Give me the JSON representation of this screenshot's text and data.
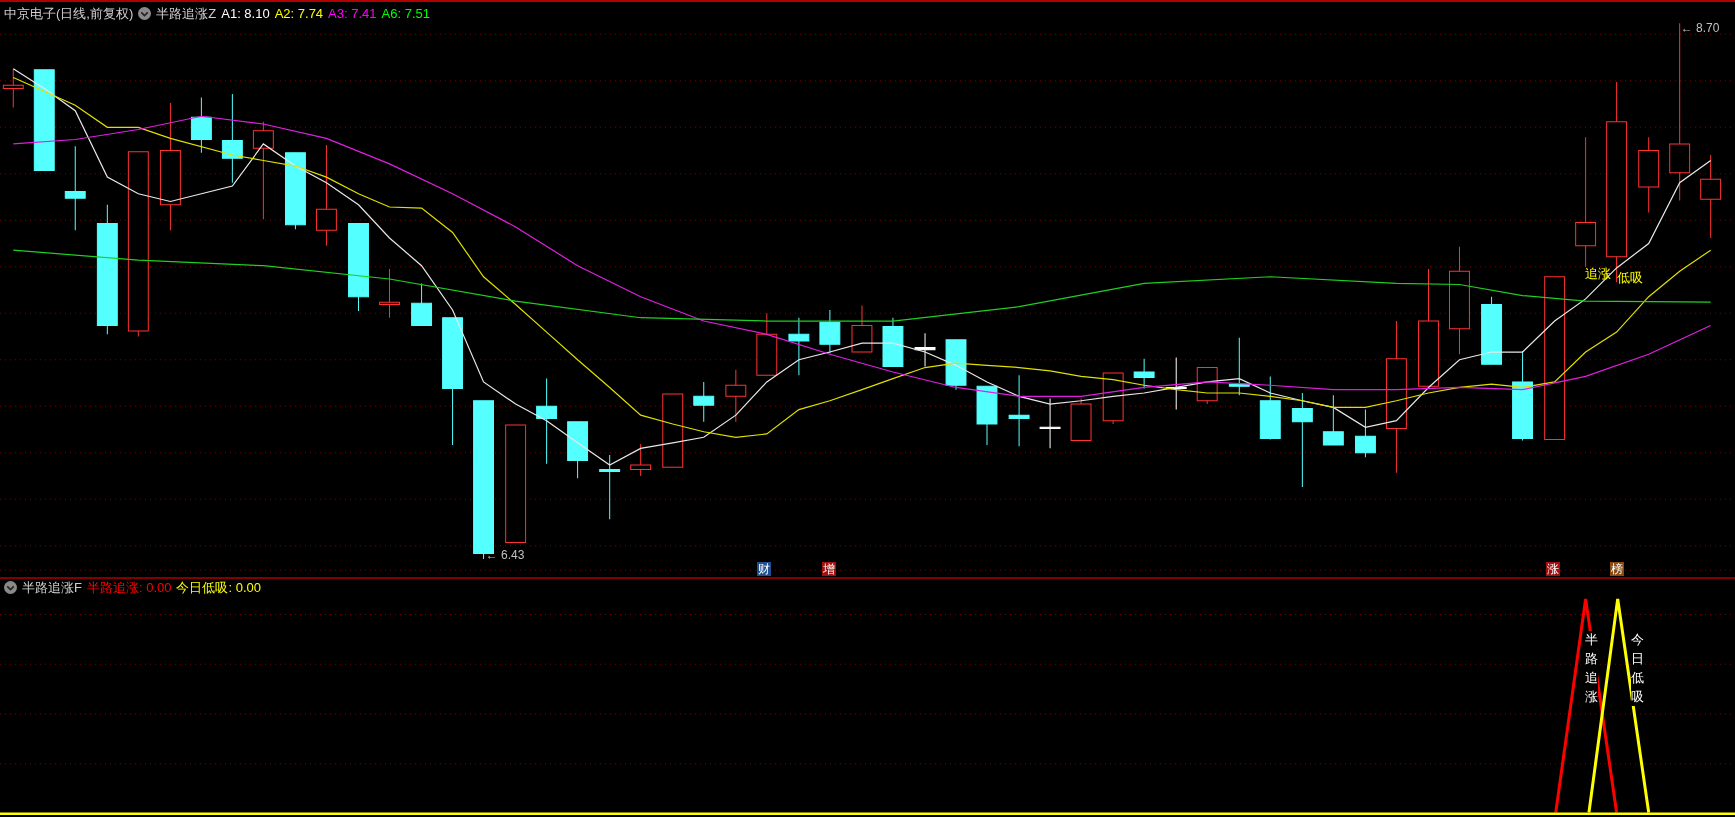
{
  "main_panel": {
    "security": "中京电子(日线,前复权)",
    "indicator": "半路追涨Z",
    "values": [
      {
        "label": "A1: 8.10",
        "color": "#ffffff"
      },
      {
        "label": "A2: 7.74",
        "color": "#ffff00"
      },
      {
        "label": "A3: 7.41",
        "color": "#ff00ff"
      },
      {
        "label": "A6: 7.51",
        "color": "#00ff00"
      }
    ],
    "price_labels": [
      {
        "kind": "high",
        "arrow": "←",
        "text": "8.70"
      },
      {
        "kind": "low",
        "arrow": "←",
        "text": "6.43"
      }
    ],
    "signal_labels": [
      "追涨",
      "低吸"
    ],
    "event_badges": [
      {
        "text": "财",
        "color": "#1f4f8f"
      },
      {
        "text": "增",
        "color": "#a01010"
      },
      {
        "text": "涨",
        "color": "#a01010"
      },
      {
        "text": "榜",
        "color": "#8a4a10"
      }
    ]
  },
  "sub_panel": {
    "indicator": "半路追涨F",
    "values": [
      {
        "label": "半路追涨: 0.00",
        "color": "#ff0000"
      },
      {
        "label": "今日低吸: 0.00",
        "color": "#ffff00"
      }
    ],
    "vertical_labels": [
      "半路追涨",
      "今日低吸"
    ]
  }
}
